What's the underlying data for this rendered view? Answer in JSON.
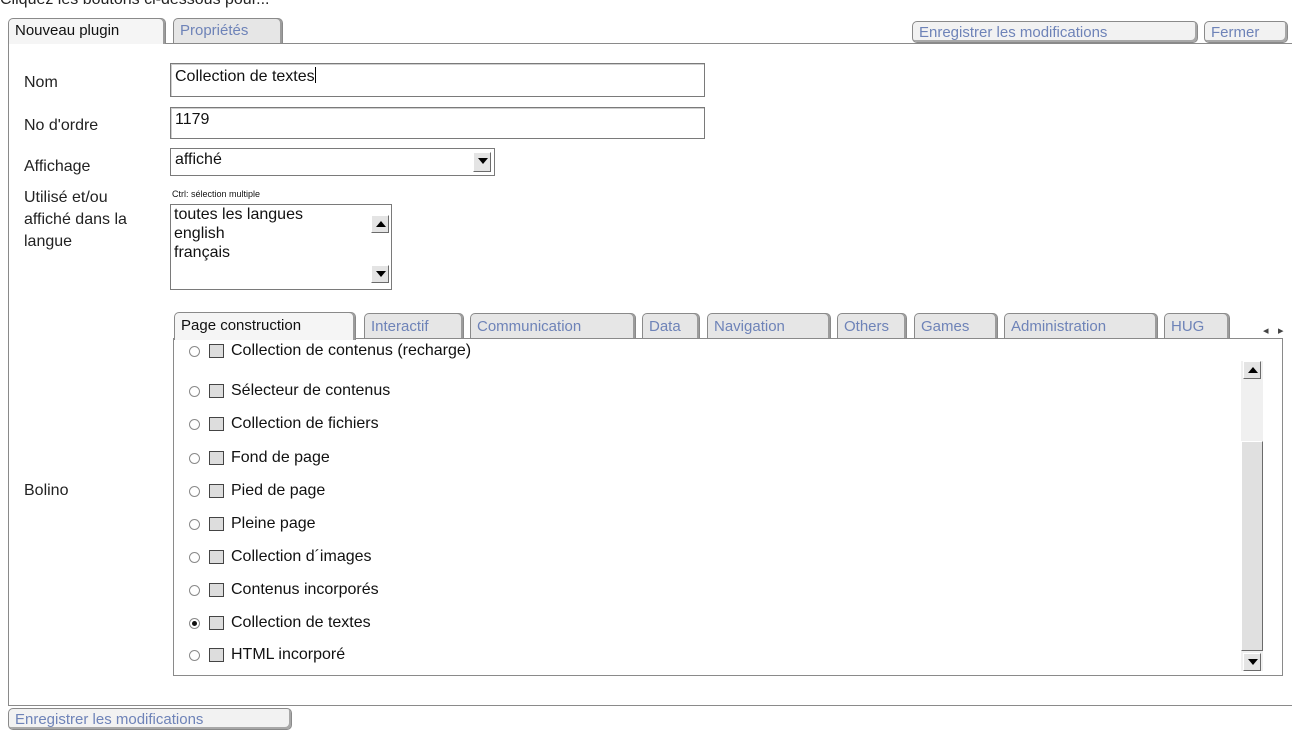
{
  "top_banner_text": "Cliquez les boutons ci-dessous pour... ",
  "header_tabs": [
    {
      "label": "Nouveau plugin",
      "active": true
    },
    {
      "label": "Propriétés",
      "active": false
    }
  ],
  "header_buttons": {
    "save": "Enregistrer les modifications",
    "close": "Fermer"
  },
  "form": {
    "name_label": "Nom",
    "name_value": "Collection de textes",
    "order_label": "No d'ordre",
    "order_value": "1179",
    "display_label": "Affichage",
    "display_value": "affiché",
    "lang_label_1": "Utilisé et/ou",
    "lang_label_2": "affiché dans la",
    "lang_label_3": "langue",
    "multi_hint": "Ctrl: sélection multiple",
    "languages": [
      "toutes les langues",
      "english",
      "français"
    ],
    "type_label": "Bolino"
  },
  "category_tabs": [
    {
      "label": "Page construction",
      "active": true
    },
    {
      "label": "Interactif",
      "active": false
    },
    {
      "label": "Communication",
      "active": false
    },
    {
      "label": "Data",
      "active": false
    },
    {
      "label": "Navigation",
      "active": false
    },
    {
      "label": "Others",
      "active": false
    },
    {
      "label": "Games",
      "active": false
    },
    {
      "label": "Administration",
      "active": false
    },
    {
      "label": "HUG",
      "active": false
    }
  ],
  "plugins": [
    {
      "label": "Collection de contenus (recharge)",
      "icon": "content-collection-icon",
      "selected": false
    },
    {
      "label": "Sélecteur de contenus",
      "icon": "content-selector-icon",
      "selected": false
    },
    {
      "label": "Collection de fichiers",
      "icon": "file-collection-icon",
      "selected": false
    },
    {
      "label": "Fond de page",
      "icon": "page-background-icon",
      "selected": false
    },
    {
      "label": "Pied de page",
      "icon": "page-footer-icon",
      "selected": false
    },
    {
      "label": "Pleine page",
      "icon": "full-page-icon",
      "selected": false
    },
    {
      "label": "Collection d´images",
      "icon": "image-collection-icon",
      "selected": false
    },
    {
      "label": "Contenus incorporés",
      "icon": "embedded-content-icon",
      "selected": false
    },
    {
      "label": "Collection de textes",
      "icon": "text-collection-icon",
      "selected": true
    },
    {
      "label": "HTML incorporé",
      "icon": "embedded-html-icon",
      "selected": false
    }
  ],
  "footer_button": "Enregistrer les modifications"
}
